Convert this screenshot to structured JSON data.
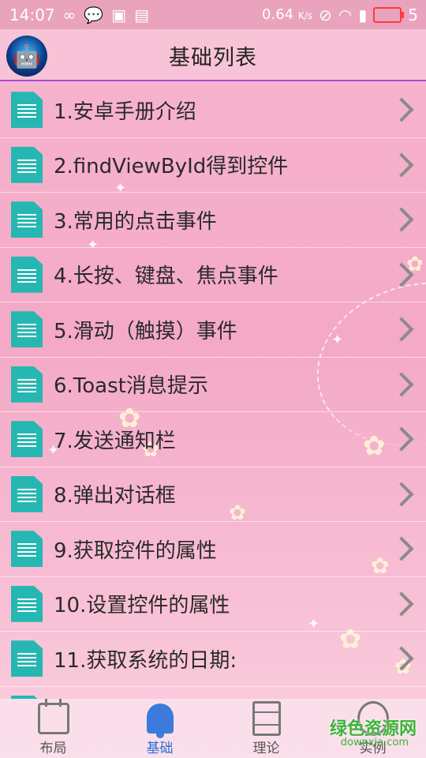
{
  "status_bar": {
    "time": "14:07",
    "speed": "0.64",
    "speed_unit": "K/s",
    "signal_number": "5"
  },
  "header": {
    "title": "基础列表"
  },
  "list": {
    "items": [
      {
        "label": "1.安卓手册介绍"
      },
      {
        "label": "2.findViewById得到控件"
      },
      {
        "label": "3.常用的点击事件"
      },
      {
        "label": "4.长按、键盘、焦点事件"
      },
      {
        "label": "5.滑动（触摸）事件"
      },
      {
        "label": "6.Toast消息提示"
      },
      {
        "label": "7.发送通知栏"
      },
      {
        "label": "8.弹出对话框"
      },
      {
        "label": "9.获取控件的属性"
      },
      {
        "label": "10.设置控件的属性"
      },
      {
        "label": "11.获取系统的日期:"
      }
    ]
  },
  "bottom_nav": {
    "tabs": [
      {
        "label": "布局",
        "icon": "calendar-icon"
      },
      {
        "label": "基础",
        "icon": "bell-icon",
        "active": true
      },
      {
        "label": "理论",
        "icon": "document-icon"
      },
      {
        "label": "实例",
        "icon": "circle-icon"
      }
    ]
  },
  "watermark": {
    "text": "绿色资源网",
    "sub": "downxia.com"
  },
  "colors": {
    "accent": "#a34ad6",
    "doc_icon": "#26b7b2",
    "active_tab": "#2d6fd6",
    "background": "#f4a9c6"
  }
}
